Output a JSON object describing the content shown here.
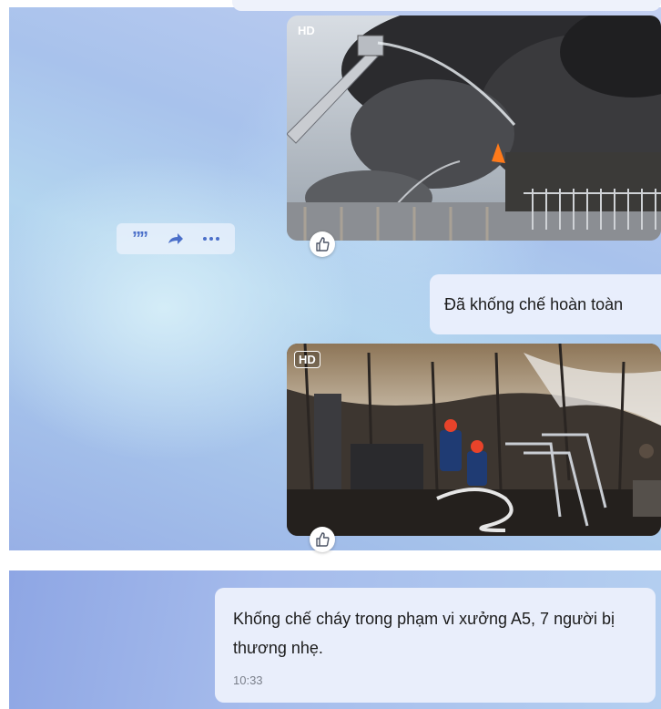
{
  "messages": {
    "photo1": {
      "badge": "HD"
    },
    "photo2": {
      "badge": "HD"
    },
    "text_short": "Đã khống chế hoàn toàn",
    "text_long": "Khống chế cháy trong phạm vi xưởng A5, 7 người bị thương nhẹ.",
    "time": "10:33"
  },
  "icons": {
    "quote": "quote-icon",
    "forward": "forward-icon",
    "more": "more-icon",
    "like": "thumbs-up-icon"
  },
  "colors": {
    "bubble": "#e8eefc",
    "accent": "#1a5dd6"
  }
}
